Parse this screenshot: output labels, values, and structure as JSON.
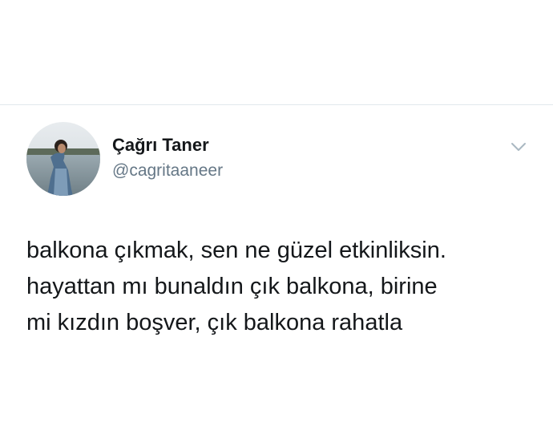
{
  "tweet": {
    "author": {
      "display_name": "Çağrı Taner",
      "handle": "@cagritaaneer",
      "avatar": "avatar-photo"
    },
    "menu_icon": "chevron-down-icon",
    "text": "balkona çıkmak, sen ne güzel etkinliksin.\nhayattan mı bunaldın çık balkona, birine\nmi kızdın boşver, çık balkona rahatla"
  },
  "colors": {
    "name": "#14171a",
    "handle": "#657786",
    "divider": "#e1e8ed",
    "chevron": "#aab8c2"
  }
}
